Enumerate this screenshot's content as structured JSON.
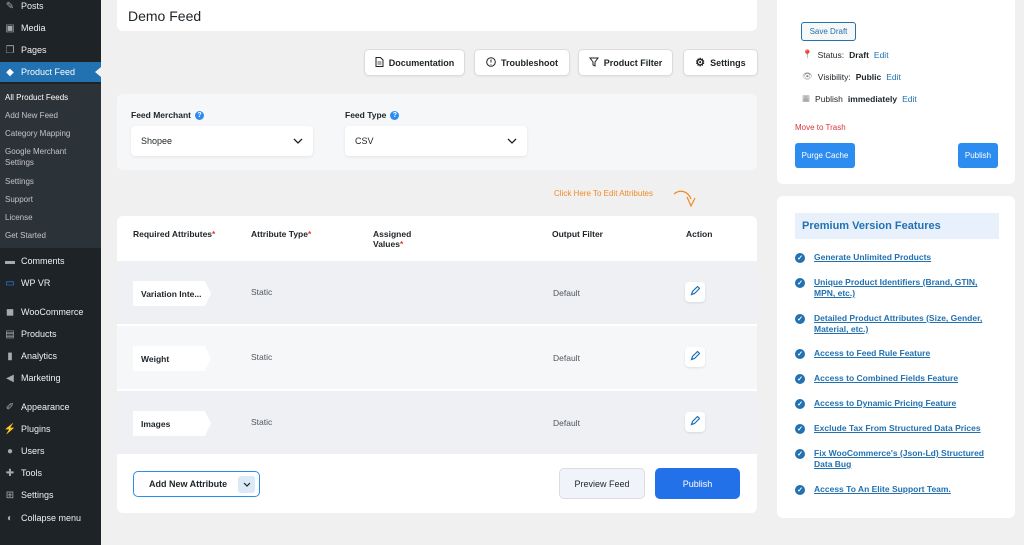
{
  "sidebar": {
    "top_items": [
      {
        "label": "Posts",
        "icon": "pin-icon"
      },
      {
        "label": "Media",
        "icon": "media-icon"
      },
      {
        "label": "Pages",
        "icon": "pages-icon"
      }
    ],
    "active": {
      "label": "Product Feed",
      "icon": "product-feed-icon"
    },
    "sub_items": [
      "All Product Feeds",
      "Add New Feed",
      "Category Mapping",
      "Google Merchant Settings",
      "Settings",
      "Support",
      "License",
      "Get Started"
    ],
    "items": [
      {
        "label": "Comments",
        "icon": "comments-icon"
      },
      {
        "label": "WP VR",
        "icon": "wpvr-icon"
      },
      {
        "label": "WooCommerce",
        "icon": "woocommerce-icon"
      },
      {
        "label": "Products",
        "icon": "products-icon"
      },
      {
        "label": "Analytics",
        "icon": "analytics-icon"
      },
      {
        "label": "Marketing",
        "icon": "megaphone-icon"
      },
      {
        "label": "Appearance",
        "icon": "brush-icon"
      },
      {
        "label": "Plugins",
        "icon": "plugins-icon"
      },
      {
        "label": "Users",
        "icon": "users-icon"
      },
      {
        "label": "Tools",
        "icon": "wrench-icon"
      },
      {
        "label": "Settings",
        "icon": "settings-icon"
      },
      {
        "label": "Collapse menu",
        "icon": "collapse-icon"
      }
    ]
  },
  "feed": {
    "title": "Demo Feed"
  },
  "toolbar": {
    "documentation": "Documentation",
    "troubleshoot": "Troubleshoot",
    "product_filter": "Product Filter",
    "settings": "Settings"
  },
  "config": {
    "merchant_label": "Feed Merchant",
    "merchant_value": "Shopee",
    "type_label": "Feed Type",
    "type_value": "CSV"
  },
  "hint": "Click Here To Edit Attributes",
  "table": {
    "headers": {
      "required": "Required Attributes",
      "type": "Attribute Type",
      "assigned_1": "Assigned",
      "assigned_2": "Values",
      "filter": "Output Filter",
      "action": "Action"
    },
    "rows": [
      {
        "attribute": "Variation Inte...",
        "type": "Static",
        "filter": "Default"
      },
      {
        "attribute": "Weight",
        "type": "Static",
        "filter": "Default"
      },
      {
        "attribute": "Images",
        "type": "Static",
        "filter": "Default"
      }
    ]
  },
  "footer": {
    "add_attribute": "Add New Attribute",
    "preview": "Preview Feed",
    "publish": "Publish"
  },
  "publish_box": {
    "save_draft": "Save Draft",
    "status_label": "Status:",
    "status_value": "Draft",
    "visibility_label": "Visibility:",
    "visibility_value": "Public",
    "publish_label": "Publish",
    "publish_value": "immediately",
    "edit": "Edit",
    "trash": "Move to Trash",
    "purge": "Purge Cache",
    "publish": "Publish"
  },
  "premium": {
    "title": "Premium Version Features",
    "features": [
      "Generate Unlimited Products",
      "Unique Product Identifiers (Brand, GTIN, MPN, etc.)",
      "Detailed Product Attributes (Size, Gender, Material, etc.)",
      "Access to Feed Rule Feature",
      "Access to Combined Fields Feature",
      "Access to Dynamic Pricing Feature",
      "Exclude Tax From Structured Data Prices",
      "Fix WooCommerce's (Json-Ld) Structured Data Bug",
      "Access To An Elite Support Team."
    ]
  },
  "colors": {
    "accent": "#2271b1",
    "primary_button": "#2d8cf0",
    "hint": "#f08a24",
    "required": "#e53935"
  }
}
